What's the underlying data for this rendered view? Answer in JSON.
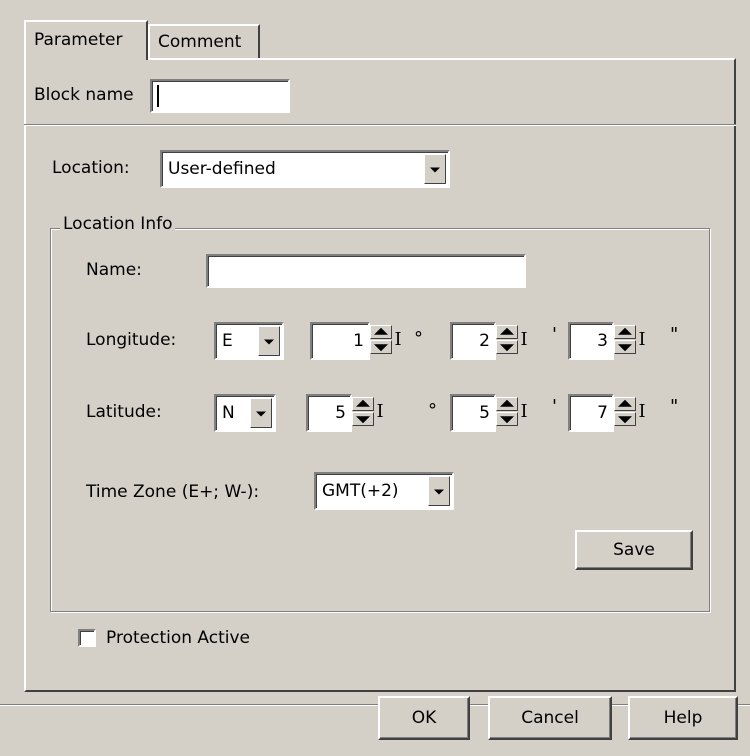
{
  "tabs": [
    {
      "label": "Parameter",
      "active": true
    },
    {
      "label": "Comment",
      "active": false
    }
  ],
  "block_name": {
    "label": "Block name",
    "value": ""
  },
  "location": {
    "label": "Location:",
    "selected": "User-defined"
  },
  "location_info": {
    "title": "Location Info",
    "name": {
      "label": "Name:",
      "value": ""
    },
    "longitude": {
      "label": "Longitude:",
      "direction": "E",
      "degrees": "1",
      "minutes": "2",
      "seconds": "3"
    },
    "latitude": {
      "label": "Latitude:",
      "direction": "N",
      "degrees": "5",
      "minutes": "5",
      "seconds": "7"
    },
    "units": {
      "degree": "°",
      "minute": "'",
      "second": "\""
    },
    "spinner_cursor_glyph": "I",
    "time_zone": {
      "label": "Time Zone (E+; W-):",
      "selected": "GMT(+2)"
    },
    "save_label": "Save"
  },
  "protection": {
    "label": "Protection Active",
    "checked": false
  },
  "buttons": {
    "ok": "OK",
    "cancel": "Cancel",
    "help": "Help"
  },
  "colors": {
    "face": "#d4d0c8",
    "shadow": "#808080",
    "highlight": "#ffffff",
    "dark": "#404040",
    "field": "#ffffff"
  },
  "icons": {
    "dropdown": "chevron-down-icon",
    "spin_up": "arrow-up-icon",
    "spin_down": "arrow-down-icon",
    "cursor": "text-cursor-icon"
  }
}
